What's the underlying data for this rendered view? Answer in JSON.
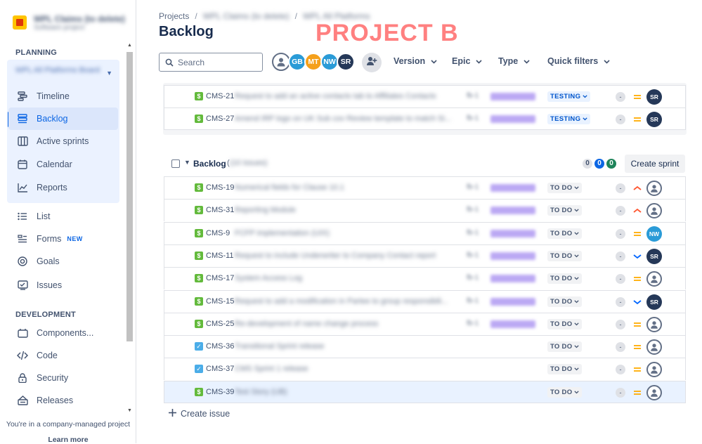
{
  "sidebar": {
    "project_name": "WPL Claims (to delete)",
    "project_type": "Software project",
    "planning_label": "PLANNING",
    "board_selector": "WPL All Platforms Board",
    "planning_items": [
      {
        "label": "Timeline",
        "icon": "timeline-icon"
      },
      {
        "label": "Backlog",
        "icon": "backlog-icon"
      },
      {
        "label": "Active sprints",
        "icon": "board-icon"
      },
      {
        "label": "Calendar",
        "icon": "calendar-icon"
      },
      {
        "label": "Reports",
        "icon": "reports-icon"
      }
    ],
    "other_items": [
      {
        "label": "List",
        "icon": "list-icon"
      },
      {
        "label": "Forms",
        "icon": "forms-icon",
        "badge": "NEW"
      },
      {
        "label": "Goals",
        "icon": "goals-icon"
      },
      {
        "label": "Issues",
        "icon": "issues-icon"
      }
    ],
    "development_label": "DEVELOPMENT",
    "development_items": [
      {
        "label": "Components...",
        "icon": "components-icon"
      },
      {
        "label": "Code",
        "icon": "code-icon"
      },
      {
        "label": "Security",
        "icon": "lock-icon"
      },
      {
        "label": "Releases",
        "icon": "releases-icon"
      }
    ],
    "footer_text": "You're in a company-managed project",
    "footer_link": "Learn more"
  },
  "header": {
    "breadcrumb": [
      "Projects",
      "WPL Claims (to delete)",
      "WPL All Platforms"
    ],
    "title": "Backlog",
    "watermark": "PROJECT B"
  },
  "toolbar": {
    "search_placeholder": "Search",
    "avatars": [
      {
        "initials": "",
        "color": "#ffffff",
        "generic": true
      },
      {
        "initials": "GB",
        "color": "#2a9bd7"
      },
      {
        "initials": "MT",
        "color": "#f5a01a"
      },
      {
        "initials": "NW",
        "color": "#2a9bd7"
      },
      {
        "initials": "SR",
        "color": "#253858"
      }
    ],
    "filters": [
      "Version",
      "Epic",
      "Type",
      "Quick filters"
    ]
  },
  "sprint_issues": [
    {
      "key": "CMS-21",
      "summary": "Request to add an active contacts tab to Affiliates Contacts",
      "flag": "fb-1",
      "status": "TESTING",
      "estimate": "-",
      "priority": "medium",
      "assignee": "SR",
      "assignee_color": "#253858",
      "type": "story"
    },
    {
      "key": "CMS-27",
      "summary": "Amend IRP logo on UK Sub cov Review template to match Si...",
      "flag": "fb-1",
      "status": "TESTING",
      "estimate": "-",
      "priority": "medium",
      "assignee": "SR",
      "assignee_color": "#253858",
      "type": "story"
    }
  ],
  "backlog": {
    "title": "Backlog",
    "count_text": "(10 issues)",
    "counts": [
      "0",
      "0",
      "0"
    ],
    "create_sprint_label": "Create sprint",
    "issues": [
      {
        "key": "CMS-19",
        "summary": "Numerical fields for Clause 10.1",
        "flag": "fb-1",
        "status": "TO DO",
        "estimate": "-",
        "priority": "high",
        "assignee": "",
        "assignee_color": "",
        "type": "story"
      },
      {
        "key": "CMS-31",
        "summary": "Reporting Module",
        "flag": "fb-1",
        "status": "TO DO",
        "estimate": "-",
        "priority": "high",
        "assignee": "",
        "assignee_color": "",
        "type": "story"
      },
      {
        "key": "CMS-9",
        "summary": "FCFP implementation (UIX)",
        "flag": "fb-1",
        "status": "TO DO",
        "estimate": "-",
        "priority": "medium",
        "assignee": "NW",
        "assignee_color": "#2a9bd7",
        "type": "story"
      },
      {
        "key": "CMS-11",
        "summary": "Request to include Underwriter to Company Contact report",
        "flag": "fb-1",
        "status": "TO DO",
        "estimate": "-",
        "priority": "low",
        "assignee": "SR",
        "assignee_color": "#253858",
        "type": "story"
      },
      {
        "key": "CMS-17",
        "summary": "System Access Log",
        "flag": "fb-1",
        "status": "TO DO",
        "estimate": "-",
        "priority": "medium",
        "assignee": "",
        "assignee_color": "",
        "type": "story"
      },
      {
        "key": "CMS-15",
        "summary": "Request to add a modification in Partee to group responsibili...",
        "flag": "fb-1",
        "status": "TO DO",
        "estimate": "-",
        "priority": "low",
        "assignee": "SR",
        "assignee_color": "#253858",
        "type": "story"
      },
      {
        "key": "CMS-25",
        "summary": "Re-development of name change process",
        "flag": "fb-1",
        "status": "TO DO",
        "estimate": "-",
        "priority": "medium",
        "assignee": "",
        "assignee_color": "",
        "type": "story"
      },
      {
        "key": "CMS-36",
        "summary": "Transitional Sprint release",
        "flag": "",
        "status": "TO DO",
        "estimate": "-",
        "priority": "medium",
        "assignee": "",
        "assignee_color": "",
        "type": "task"
      },
      {
        "key": "CMS-37",
        "summary": "CMS Sprint 1 release",
        "flag": "",
        "status": "TO DO",
        "estimate": "-",
        "priority": "medium",
        "assignee": "",
        "assignee_color": "",
        "type": "task"
      },
      {
        "key": "CMS-39",
        "summary": "Test Story (UB)",
        "flag": "",
        "status": "TO DO",
        "estimate": "-",
        "priority": "medium",
        "assignee": "",
        "assignee_color": "",
        "type": "story"
      }
    ],
    "create_issue_label": "Create issue"
  },
  "colors": {
    "accent": "#0c66e4",
    "story": "#63ba3c",
    "task": "#4bade8",
    "priority_high": "#ff5630",
    "priority_medium": "#ffab00",
    "priority_low": "#0065ff"
  }
}
